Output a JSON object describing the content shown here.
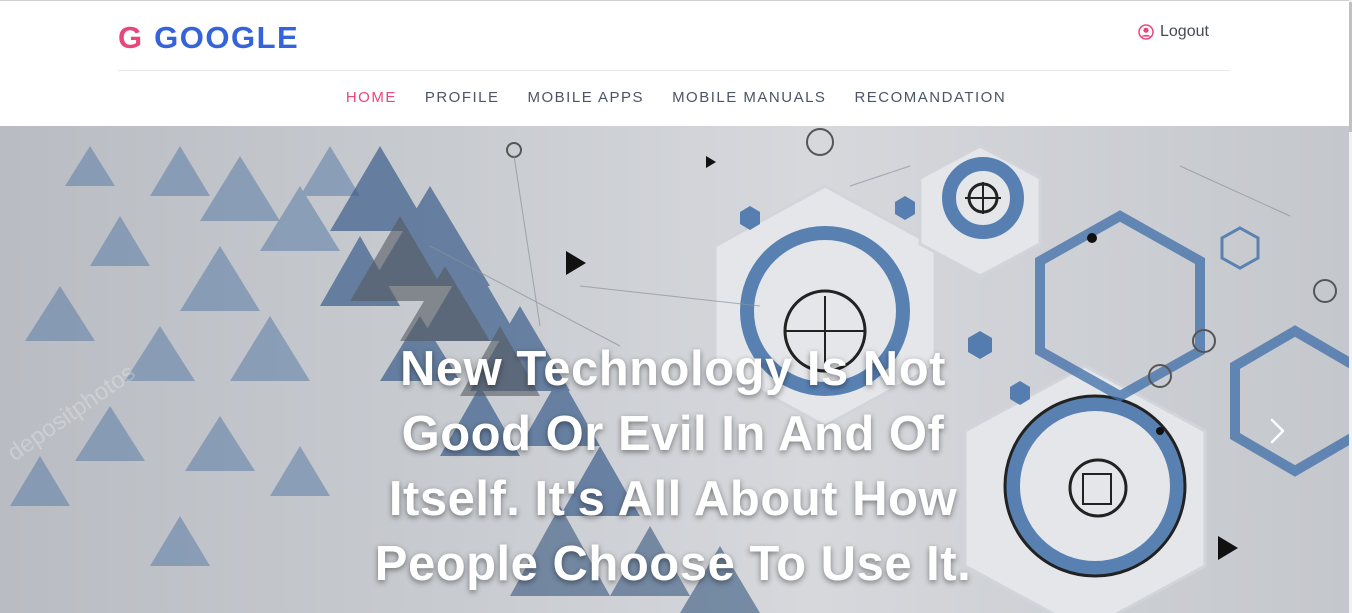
{
  "brand": {
    "letter": "G",
    "name": "GOOGLE"
  },
  "account": {
    "logout_label": "Logout",
    "icon": "user-circle-icon"
  },
  "nav": {
    "items": [
      {
        "label": "HOME",
        "active": true
      },
      {
        "label": "PROFILE",
        "active": false
      },
      {
        "label": "MOBILE APPS",
        "active": false
      },
      {
        "label": "MOBILE MANUALS",
        "active": false
      },
      {
        "label": "RECOMANDATION",
        "active": false
      }
    ]
  },
  "hero": {
    "headline": "New Technology Is Not Good Or Evil In And Of Itself. It's All About How People Choose To Use It.",
    "next_icon": "chevron-right-icon"
  },
  "colors": {
    "accent": "#e9467a",
    "brand_blue": "#3563d9",
    "nav_text": "#4b5565",
    "hero_blue": "#3f6ea8"
  }
}
